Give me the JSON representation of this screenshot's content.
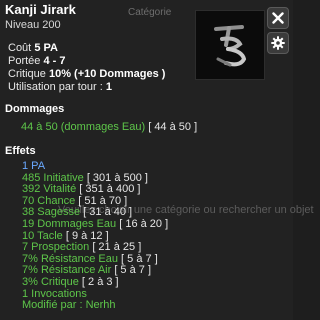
{
  "item": {
    "name": "Kanji Jirark",
    "level": "Niveau  200",
    "category_label": "Catégorie"
  },
  "background_hint": "Veuillez choisir une catégorie ou rechercher un objet",
  "stats": {
    "cout_label": "Coût",
    "cout_value": "5 PA",
    "portee_label": "Portée",
    "portee_value": "4 - 7",
    "crit_label": "Critique",
    "crit_value": "10% (+10 Dommages )",
    "util_label": "Utilisation par tour :",
    "util_value": "1"
  },
  "damages": {
    "title": "Dommages",
    "text": "44 à 50 (dommages Eau)",
    "range": "[ 44 à 50 ]"
  },
  "effects": {
    "title": "Effets",
    "items": [
      {
        "text": "1 PA",
        "range": "",
        "color": "#6aa9ff"
      },
      {
        "text": "485 Initiative",
        "range": "[ 301 à 500 ]",
        "color": "#5ec64a"
      },
      {
        "text": "392 Vitalité",
        "range": "[ 351 à 400 ]",
        "color": "#5ec64a"
      },
      {
        "text": "70 Chance",
        "range": "[ 51 à 70 ]",
        "color": "#5ec64a"
      },
      {
        "text": "38 Sagesse",
        "range": "[ 31 à 40 ]",
        "color": "#5ec64a"
      },
      {
        "text": "19 Dommages Eau",
        "range": "[ 16 à 20 ]",
        "color": "#5ec64a"
      },
      {
        "text": "10 Tacle",
        "range": "[ 9 à 12 ]",
        "color": "#5ec64a"
      },
      {
        "text": "7 Prospection",
        "range": "[ 21 à 25 ]",
        "color": "#5ec64a"
      },
      {
        "text": "7% Résistance Eau",
        "range": "[ 5 à 7 ]",
        "color": "#5ec64a"
      },
      {
        "text": "7% Résistance Air",
        "range": "[ 5 à 7 ]",
        "color": "#5ec64a"
      },
      {
        "text": "3% Critique",
        "range": "[ 2 à 3 ]",
        "color": "#5ec64a"
      },
      {
        "text": "1 Invocations",
        "range": "",
        "color": "#5ec64a"
      },
      {
        "text": "Modifié par : Nerhh",
        "range": "",
        "color": "#5ec64a"
      }
    ]
  },
  "buttons": {
    "close_icon": "close-icon",
    "settings_icon": "gear-icon"
  },
  "colors": {
    "background": "#222222",
    "effect_green": "#5ec64a",
    "effect_blue": "#6aa9ff"
  }
}
